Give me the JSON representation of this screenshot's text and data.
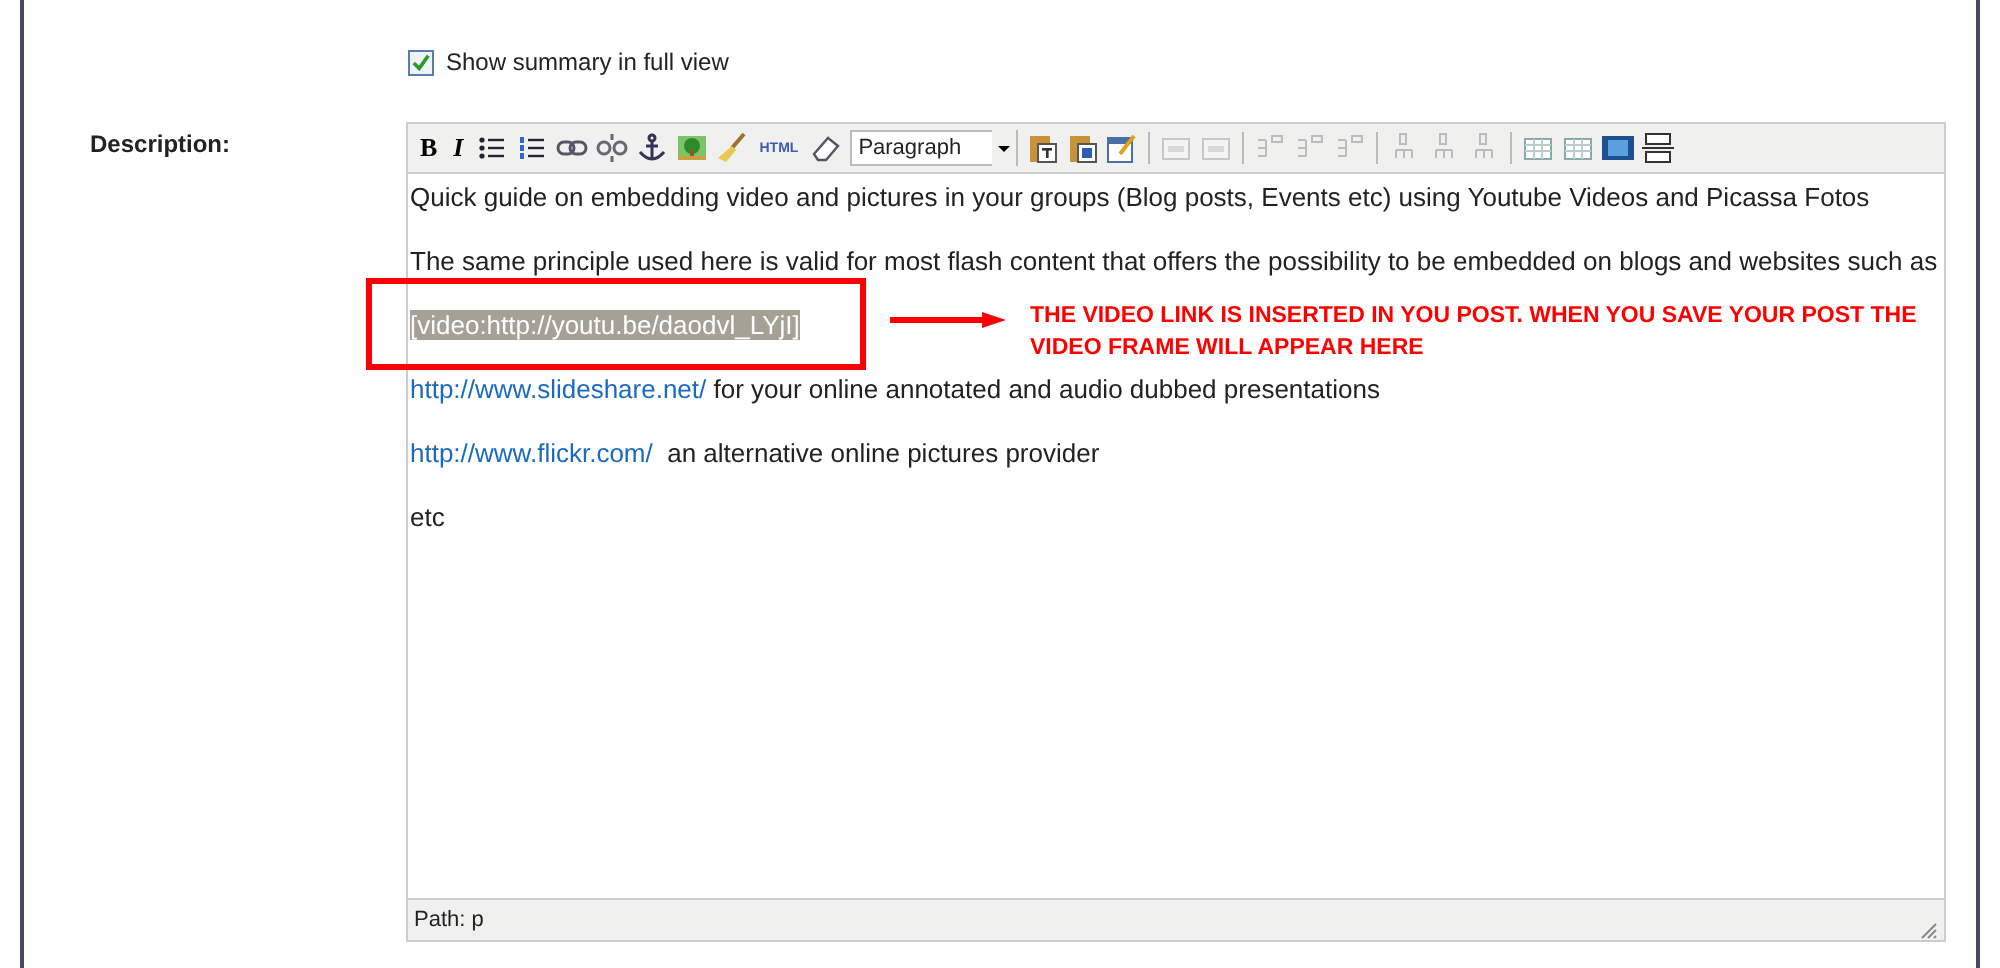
{
  "summary_option": {
    "label": "Show summary in full view",
    "checked": true
  },
  "description": {
    "label": "Description:",
    "toolbar": [
      {
        "kind": "bold",
        "text": "B"
      },
      {
        "kind": "italic",
        "text": "I"
      },
      {
        "kind": "bullets"
      },
      {
        "kind": "numbers"
      },
      {
        "kind": "link"
      },
      {
        "kind": "unlink"
      },
      {
        "kind": "anchor"
      },
      {
        "kind": "image"
      },
      {
        "kind": "cleanup"
      },
      {
        "kind": "html",
        "text": "HTML"
      },
      {
        "kind": "eraser"
      },
      {
        "kind": "format",
        "text": "Paragraph"
      },
      {
        "kind": "paste-text"
      },
      {
        "kind": "paste-word"
      },
      {
        "kind": "edit"
      },
      {
        "kind": "sep"
      },
      {
        "kind": "table-grey"
      },
      {
        "kind": "table-grey"
      },
      {
        "kind": "sep"
      },
      {
        "kind": "row-grey"
      },
      {
        "kind": "row-grey"
      },
      {
        "kind": "row-grey"
      },
      {
        "kind": "sep"
      },
      {
        "kind": "col-grey"
      },
      {
        "kind": "col-grey"
      },
      {
        "kind": "col-grey"
      },
      {
        "kind": "sep"
      },
      {
        "kind": "table"
      },
      {
        "kind": "table"
      },
      {
        "kind": "media"
      },
      {
        "kind": "hr"
      }
    ],
    "paragraphs": [
      {
        "kind": "text",
        "text": "Quick guide on embedding video and pictures in your groups (Blog posts, Events etc) using Youtube Videos and Picassa Fotos"
      },
      {
        "kind": "text",
        "text": "The same principle used here is valid for most flash content that offers the possibility to be embedded on blogs and websites such as"
      },
      {
        "kind": "selected",
        "text": "[video:http://youtu.be/daodvl_LYjI]"
      },
      {
        "kind": "link",
        "link": "http://www.slideshare.net/",
        "text": " for your online annotated and audio dubbed presentations"
      },
      {
        "kind": "link",
        "link": "http://www.flickr.com/",
        "text": "  an alternative online pictures provider"
      },
      {
        "kind": "text",
        "text": "etc"
      }
    ],
    "path": "Path: p"
  },
  "annotation": {
    "text": "THE VIDEO LINK IS INSERTED IN YOU POST. WHEN YOU SAVE YOUR POST THE VIDEO FRAME WILL APPEAR HERE"
  }
}
